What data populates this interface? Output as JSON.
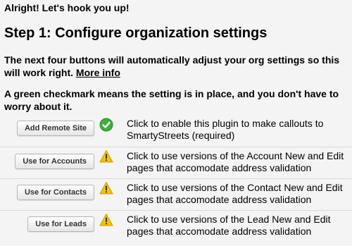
{
  "greeting": "Alright! Let's hook you up!",
  "step_title": "Step 1: Configure organization settings",
  "intro": {
    "text": "The next four buttons will automatically adjust your org settings so this will work right.",
    "link": "More info"
  },
  "checkmark_note": "A green checkmark means the setting is in place, and you don't have to worry about it.",
  "settings": [
    {
      "button": "Add Remote Site",
      "status": "done",
      "status_icon": "green-checkmark-icon",
      "description": "Click to enable this plugin to make callouts to SmartyStreets (required)"
    },
    {
      "button": "Use for Accounts",
      "status": "warning",
      "status_icon": "warning-icon",
      "description": "Click to use versions of the Account New and Edit pages that accomodate address validation"
    },
    {
      "button": "Use for Contacts",
      "status": "warning",
      "status_icon": "warning-icon",
      "description": "Click to use versions of the Contact New and Edit pages that accomodate address validation"
    },
    {
      "button": "Use for Leads",
      "status": "warning",
      "status_icon": "warning-icon",
      "description": "Click to use versions of the Lead New and Edit pages that accomodate address validation"
    }
  ],
  "colors": {
    "background": "#f4f4f4",
    "check_green": "#3fae3f",
    "warning_yellow": "#f5c400",
    "divider": "#d8d8d8"
  }
}
